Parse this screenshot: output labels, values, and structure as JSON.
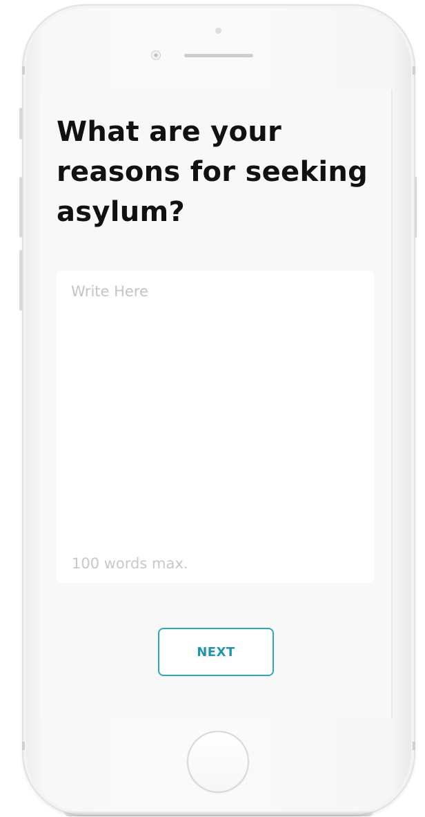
{
  "question": {
    "title": "What are your reasons for seeking asylum?"
  },
  "answer": {
    "placeholder": "Write Here",
    "value": "",
    "limit_hint": "100 words max."
  },
  "actions": {
    "next_label": "NEXT"
  },
  "colors": {
    "accent": "#2fa6c0",
    "screen_background": "#f8f8f8",
    "title_text": "#111111",
    "placeholder_text": "#c4c4c4"
  },
  "device": {
    "frame": "white-smartphone",
    "home_button": "home-button-icon"
  }
}
